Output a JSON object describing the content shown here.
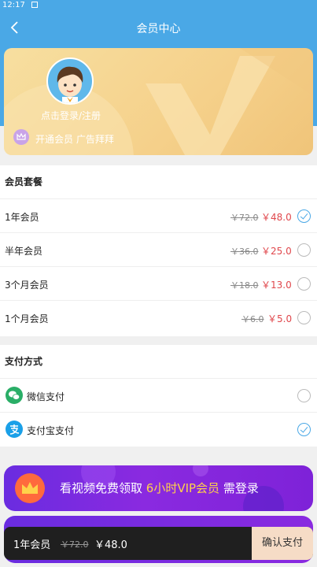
{
  "status_bar": {
    "time": "12:17"
  },
  "header": {
    "title": "会员中心"
  },
  "profile": {
    "login_text": "点击登录/注册",
    "vip_text": "开通会员 广告拜拜"
  },
  "plans": {
    "title": "会员套餐",
    "items": [
      {
        "name": "1年会员",
        "old_price": "￥72.0",
        "price": "￥48.0",
        "selected": true
      },
      {
        "name": "半年会员",
        "old_price": "￥36.0",
        "price": "￥25.0",
        "selected": false
      },
      {
        "name": "3个月会员",
        "old_price": "￥18.0",
        "price": "￥13.0",
        "selected": false
      },
      {
        "name": "1个月会员",
        "old_price": "￥6.0",
        "price": "￥5.0",
        "selected": false
      }
    ]
  },
  "payment": {
    "title": "支付方式",
    "methods": [
      {
        "name": "微信支付",
        "icon": "wechat-icon",
        "color": "#2aae67",
        "selected": false
      },
      {
        "name": "支付宝支付",
        "icon": "alipay-icon",
        "color": "#1aa0e8",
        "selected": true
      }
    ]
  },
  "banner": {
    "text_prefix": "看视频免费领取 ",
    "highlight": "6小时VIP会员",
    "text_suffix": " 需登录"
  },
  "pay_bar": {
    "plan": "1年会员",
    "old_price": "￥72.0",
    "price": "￥48.0",
    "confirm": "确认支付"
  },
  "colors": {
    "primary": "#4aa8e6",
    "price": "#e0474c",
    "card": "#f5d08a",
    "banner": "#7e22d8"
  }
}
